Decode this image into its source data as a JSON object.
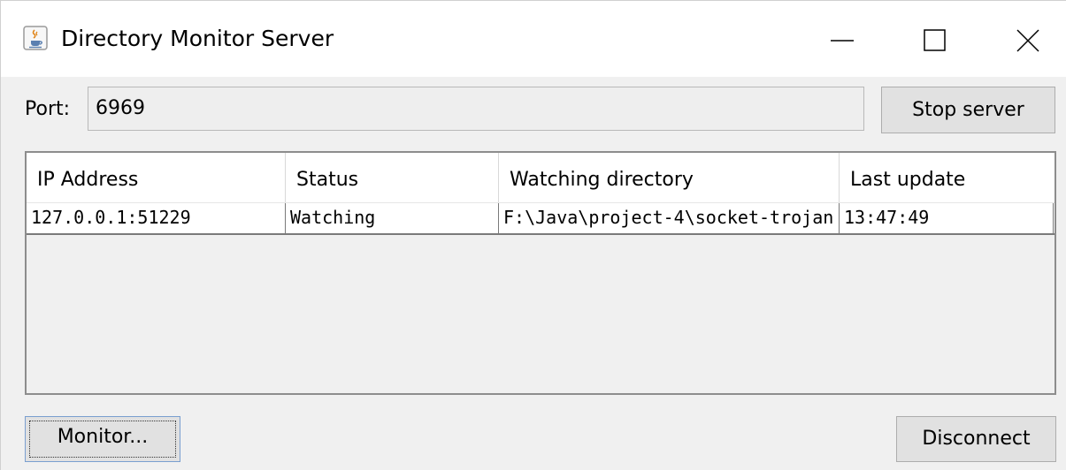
{
  "window": {
    "title": "Directory Monitor Server",
    "app_icon": "java-cup-icon",
    "controls": [
      "minimize-icon",
      "maximize-icon",
      "close-icon"
    ]
  },
  "port": {
    "label": "Port:",
    "value": "6969"
  },
  "buttons": {
    "stop_server": "Stop server",
    "monitor": "Monitor...",
    "disconnect": "Disconnect"
  },
  "table": {
    "columns": [
      "IP Address",
      "Status",
      "Watching directory",
      "Last update"
    ],
    "rows": [
      [
        "127.0.0.1:51229",
        "Watching",
        "F:\\Java\\project-4\\socket-trojan",
        "13:47:49"
      ]
    ]
  }
}
